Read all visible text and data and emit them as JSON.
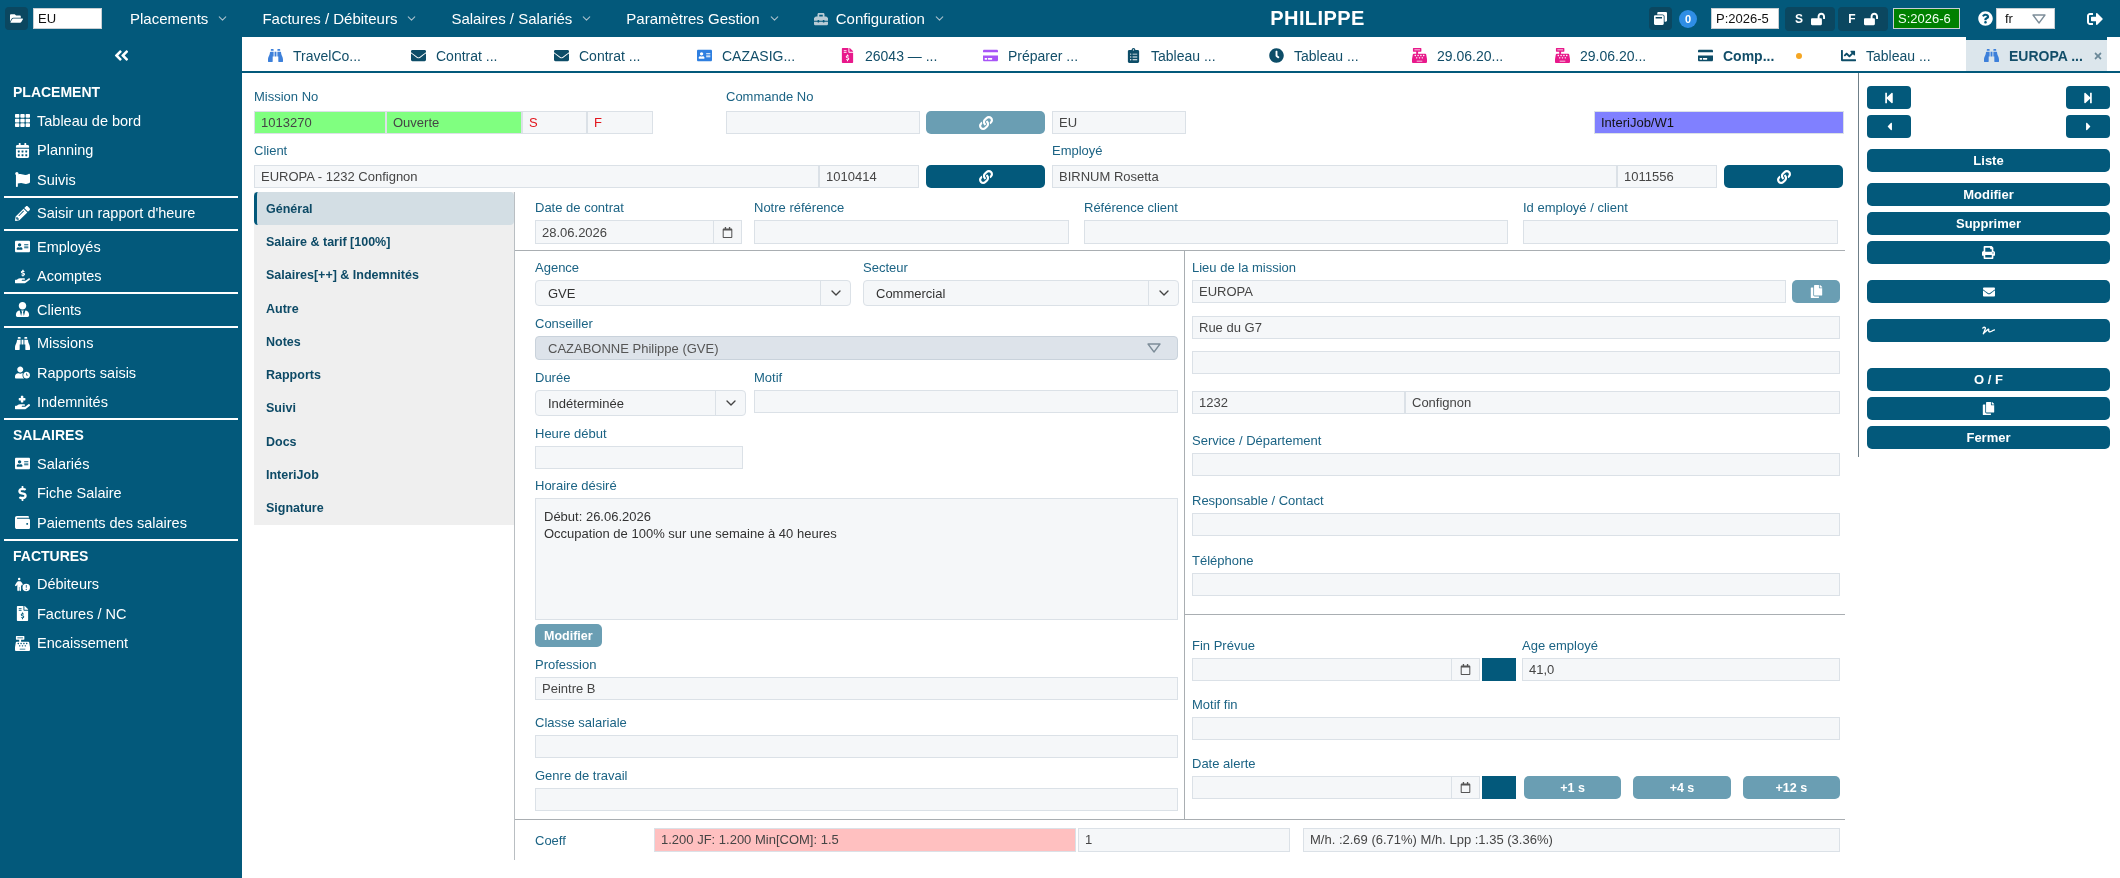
{
  "top_bar": {
    "search": {
      "value": "EU"
    },
    "menus": [
      {
        "label": "Placements",
        "kind": "menu"
      },
      {
        "label": "Factures / Débiteurs",
        "kind": "menu"
      },
      {
        "label": "Salaires / Salariés",
        "kind": "menu"
      },
      {
        "label": "Paramètres Gestion",
        "kind": "menu"
      },
      {
        "label": "Configuration",
        "kind": "settings"
      }
    ],
    "title": "PHILIPPE",
    "counter": "0",
    "period": {
      "value": "P:2026-5"
    },
    "locks": [
      {
        "label": "S",
        "locked": false
      },
      {
        "label": "F",
        "locked": false
      }
    ],
    "salary_period": {
      "value": "S:2026-6",
      "color": "#008000"
    },
    "language": {
      "value": "fr"
    }
  },
  "sidebar": {
    "sections": [
      {
        "title": "PLACEMENT",
        "groups": [
          [
            {
              "label": "Tableau de bord",
              "kind": "dashboard"
            },
            {
              "label": "Planning",
              "kind": "planning"
            },
            {
              "label": "Suivis",
              "kind": "followup"
            }
          ],
          [
            {
              "label": "Saisir un rapport d'heure",
              "kind": "timesheet"
            }
          ],
          [
            {
              "label": "Employés",
              "kind": "employees"
            },
            {
              "label": "Acomptes",
              "kind": "advances"
            }
          ],
          [
            {
              "label": "Clients",
              "kind": "clients"
            }
          ],
          [
            {
              "label": "Missions",
              "kind": "missions"
            },
            {
              "label": "Rapports saisis",
              "kind": "reports"
            },
            {
              "label": "Indemnités",
              "kind": "allowances"
            }
          ]
        ]
      },
      {
        "title": "SALAIRES",
        "groups": [
          [
            {
              "label": "Salariés",
              "kind": "staff"
            },
            {
              "label": "Fiche Salaire",
              "kind": "payslip"
            },
            {
              "label": "Paiements des salaires",
              "kind": "payments"
            }
          ]
        ]
      },
      {
        "title": "FACTURES",
        "groups": [
          [
            {
              "label": "Débiteurs",
              "kind": "debtors"
            },
            {
              "label": "Factures / NC",
              "kind": "invoices"
            },
            {
              "label": "Encaissement",
              "kind": "cashing"
            }
          ]
        ]
      }
    ]
  },
  "tabs": [
    {
      "label": "TravelCo...",
      "kind": "mission",
      "selected": false,
      "modified": false
    },
    {
      "label": "Contrat ...",
      "kind": "contract",
      "selected": false,
      "modified": false
    },
    {
      "label": "Contrat ...",
      "kind": "contract",
      "selected": false,
      "modified": false
    },
    {
      "label": "CAZASIG...",
      "kind": "employee",
      "selected": false,
      "modified": false
    },
    {
      "label": "26043 — ...",
      "kind": "invoice",
      "selected": false,
      "modified": false
    },
    {
      "label": "Préparer ...",
      "kind": "payment",
      "selected": false,
      "modified": false
    },
    {
      "label": "Tableau ...",
      "kind": "board",
      "selected": false,
      "modified": false
    },
    {
      "label": "Tableau ...",
      "kind": "timesheet",
      "selected": false,
      "modified": false
    },
    {
      "label": "29.06.20...",
      "kind": "cash",
      "selected": false,
      "modified": false
    },
    {
      "label": "29.06.20...",
      "kind": "cash",
      "selected": false,
      "modified": false
    },
    {
      "label": "Comp...",
      "kind": "account",
      "selected": false,
      "modified": true
    },
    {
      "label": "Tableau ...",
      "kind": "chart",
      "selected": false,
      "modified": false
    },
    {
      "label": "EUROPA ...",
      "kind": "mission",
      "selected": true,
      "modified": false
    }
  ],
  "header": {
    "mission": {
      "label": "Mission No",
      "number": {
        "value": "1013270",
        "color": "#80ff80"
      },
      "status": {
        "value": "Ouverte",
        "color": "#80ff80"
      },
      "flags": [
        "S",
        "F"
      ]
    },
    "order": {
      "label": "Commande No",
      "link_disabled": true,
      "agency": "EU"
    },
    "channel": {
      "value": "InteriJob/W1",
      "color": "#8080ff"
    },
    "client": {
      "label": "Client",
      "name": "EUROPA - 1232 Confignon",
      "number": "1010414",
      "link_disabled": false
    },
    "employee": {
      "label": "Employé",
      "name": "BIRNUM Rosetta",
      "number": "1011556",
      "link_disabled": false
    }
  },
  "side_tabs": [
    {
      "label": "Général",
      "selected": true
    },
    {
      "label": "Salaire & tarif [100%]",
      "selected": false
    },
    {
      "label": "Salaires[++] & Indemnités",
      "selected": false
    },
    {
      "label": "Autre",
      "selected": false
    },
    {
      "label": "Notes",
      "selected": false
    },
    {
      "label": "Rapports",
      "selected": false
    },
    {
      "label": "Suivi",
      "selected": false
    },
    {
      "label": "Docs",
      "selected": false
    },
    {
      "label": "InteriJob",
      "selected": false
    },
    {
      "label": "Signature",
      "selected": false
    }
  ],
  "form": {
    "row": [
      {
        "label": "Date de contrat",
        "kind": "date",
        "value": "28.06.2026"
      },
      {
        "label": "Notre référence",
        "kind": "text"
      },
      {
        "label": "Référence client",
        "kind": "text"
      },
      {
        "label": "Id employé / client",
        "kind": "text"
      }
    ],
    "agency": {
      "label": "Agence",
      "value": "GVE"
    },
    "sector": {
      "label": "Secteur",
      "value": "Commercial"
    },
    "advisor": {
      "label": "Conseiller",
      "value": "CAZABONNE Philippe (GVE)",
      "disabled": true
    },
    "duration": {
      "label": "Durée",
      "value": "Indéterminée"
    },
    "reason": {
      "label": "Motif"
    },
    "start_time": {
      "label": "Heure début"
    },
    "schedule": {
      "label": "Horaire désiré",
      "value": "Début: 26.06.2026\nOccupation de 100% sur une semaine à 40 heures",
      "button": "Modifier"
    },
    "profession": {
      "label": "Profession",
      "value": "Peintre B"
    },
    "salary_class": {
      "label": "Classe salariale"
    },
    "work_type": {
      "label": "Genre de travail"
    },
    "location": {
      "label": "Lieu de la mission",
      "name": "EUROPA",
      "street": "Rue du G7",
      "postcode": "1232",
      "city": "Confignon"
    },
    "department": {
      "label": "Service / Département"
    },
    "contact": {
      "label": "Responsable / Contact"
    },
    "phone": {
      "label": "Téléphone"
    },
    "end_date": {
      "label": "Fin Prévue"
    },
    "employee_age": {
      "label": "Age employé",
      "value": "41,0"
    },
    "end_reason": {
      "label": "Motif fin"
    },
    "alert_date": {
      "label": "Date alerte",
      "shortcuts": [
        "+1 s",
        "+4 s",
        "+12 s"
      ]
    },
    "coeff": {
      "label": "Coeff",
      "values": [
        {
          "value": "1.200 JF: 1.200 Min[COM]: 1.5",
          "color": "#ffc0c0"
        },
        {
          "value": "1"
        },
        {
          "value": "M/h. :2.69 (6.71%) M/h. Lpp :1.35 (3.36%)"
        }
      ]
    }
  },
  "actions": {
    "groups": [
      [
        {
          "kind": "text",
          "label": "Liste"
        }
      ],
      [
        {
          "kind": "text",
          "label": "Modifier"
        },
        {
          "kind": "text",
          "label": "Supprimer"
        },
        {
          "kind": "print"
        }
      ],
      [
        {
          "kind": "mail"
        }
      ],
      [
        {
          "kind": "sign"
        }
      ],
      [
        {
          "kind": "text",
          "label": "O / F"
        },
        {
          "kind": "copy"
        },
        {
          "kind": "text",
          "label": "Fermer"
        }
      ]
    ]
  }
}
